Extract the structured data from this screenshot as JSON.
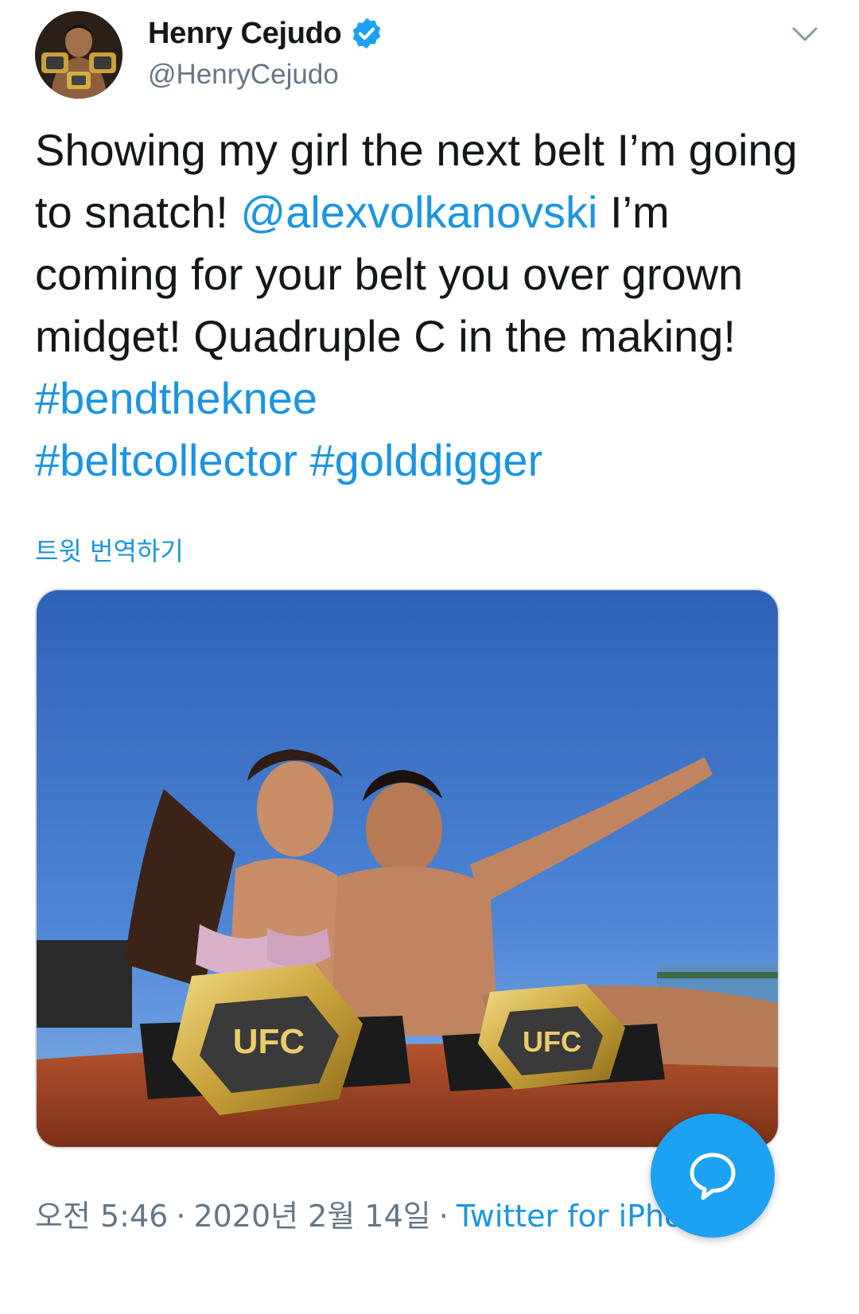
{
  "author": {
    "display_name": "Henry Cejudo",
    "handle": "@HenryCejudo",
    "verified": true,
    "avatar_icon": "avatar-photo"
  },
  "tweet": {
    "segments": [
      {
        "text": "Showing my girl the next belt I’m going to snatch! ",
        "type": "text"
      },
      {
        "text": "@alexvolkanovski",
        "type": "mention"
      },
      {
        "text": " I’m coming for your belt you over grown midget! Quadruple C in the making! ",
        "type": "text"
      },
      {
        "text": "#bendtheknee",
        "type": "hashtag"
      },
      {
        "text": " ",
        "type": "text"
      },
      {
        "text": "#beltcollector",
        "type": "hashtag"
      },
      {
        "text": " ",
        "type": "text"
      },
      {
        "text": "#golddigger",
        "type": "hashtag"
      }
    ],
    "translate_label": "트윗 번역하기"
  },
  "meta": {
    "time": "오전 5:46",
    "date": "2020년 2월 14일",
    "separator": "·",
    "source": "Twitter for iPho"
  },
  "colors": {
    "link": "#1b95e0",
    "fab": "#1da1f2",
    "muted": "#657786"
  },
  "icons": {
    "verified": "verified-badge-icon",
    "more": "chevron-down-icon",
    "compose": "reply-bubble-icon"
  }
}
